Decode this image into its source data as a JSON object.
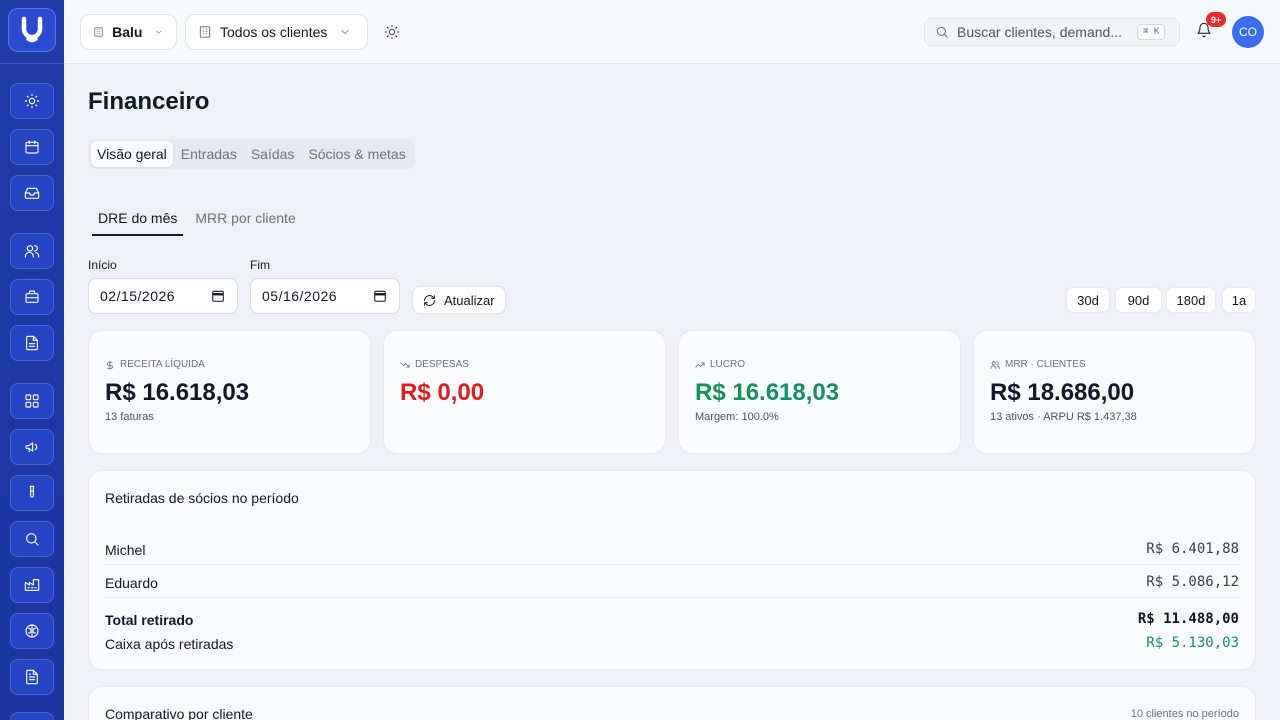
{
  "colors": {
    "sidebar": "#1e3aa8",
    "accent": "#3b6cf0",
    "negative": "#e01d1d",
    "positive": "#12925d",
    "badge": "#ef2a2a"
  },
  "sidebar": {
    "logo": "U",
    "items": [
      "sun-icon",
      "calendar-icon",
      "inbox-icon",
      "users-icon",
      "briefcase-icon",
      "file-icon",
      "grid-icon",
      "megaphone-icon",
      "flask-icon",
      "search-icon",
      "factory-icon",
      "brain-icon",
      "document-icon"
    ]
  },
  "topbar": {
    "workspace": "Balu",
    "client_filter": "Todos os clientes",
    "search_placeholder": "Buscar clientes, demand...",
    "shortcut": "⌘ K",
    "notifications_badge": "9+",
    "avatar_initials": "CO"
  },
  "page": {
    "title": "Financeiro",
    "tabs": [
      "Visão geral",
      "Entradas",
      "Saídas",
      "Sócios & metas"
    ],
    "subtabs": [
      "DRE do mês",
      "MRR por cliente"
    ]
  },
  "filters": {
    "start_label": "Início",
    "start_value": "02/15/2026",
    "end_label": "Fim",
    "end_value": "05/16/2026",
    "refresh_label": "Atualizar",
    "ranges": [
      "30d",
      "90d",
      "180d",
      "1a"
    ]
  },
  "kpis": [
    {
      "label": "Receita líquida",
      "value": "R$ 16.618,03",
      "sub": "13 faturas"
    },
    {
      "label": "Despesas",
      "value": "R$ 0,00",
      "sub": ""
    },
    {
      "label": "Lucro",
      "value": "R$ 16.618,03",
      "sub": "Margem: 100.0%"
    },
    {
      "label": "MRR · Clientes",
      "value": "R$ 18.686,00",
      "sub": "13 ativos · ARPU R$ 1.437,38"
    }
  ],
  "withdrawals": {
    "title": "Retiradas de sócios no período",
    "rows": [
      {
        "name": "Michel",
        "value": "R$ 6.401,88"
      },
      {
        "name": "Eduardo",
        "value": "R$ 5.086,12"
      }
    ],
    "total_label": "Total retirado",
    "total_value": "R$ 11.488,00",
    "cash_label": "Caixa após retiradas",
    "cash_value": "R$ 5.130,03"
  },
  "comparison": {
    "title": "Comparativo por cliente",
    "meta": "10 clientes no período"
  }
}
